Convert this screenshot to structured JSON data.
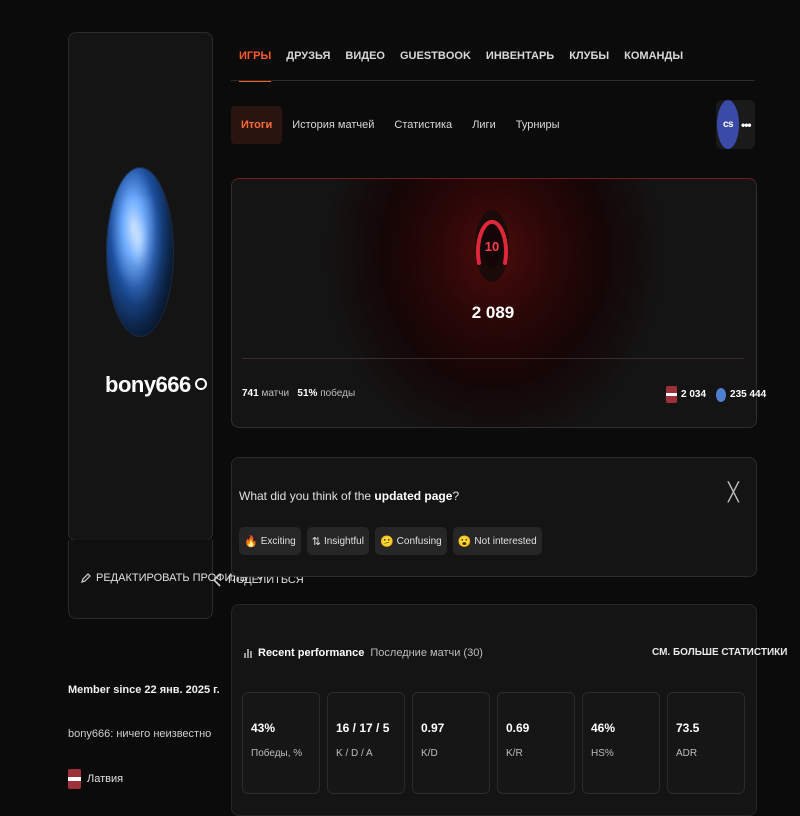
{
  "profile": {
    "username": "bony666",
    "edit_label": "РЕДАКТИРОВАТЬ ПРОФИЛЬ",
    "share_label": "ПОДЕЛИТЬСЯ",
    "member_since": "Member since 22 янв. 2025 г.",
    "bio": "bony666: ничего неизвестно",
    "country": "Латвия"
  },
  "top_tabs": [
    {
      "label": "ИГРЫ",
      "active": true
    },
    {
      "label": "ДРУЗЬЯ"
    },
    {
      "label": "ВИДЕО"
    },
    {
      "label": "GUESTBOOK"
    },
    {
      "label": "ИНВЕНТАРЬ"
    },
    {
      "label": "КЛУБЫ"
    },
    {
      "label": "КОМАНДЫ"
    }
  ],
  "sub_tabs": [
    {
      "label": "Итоги",
      "active": true
    },
    {
      "label": "История матчей"
    },
    {
      "label": "Статистика"
    },
    {
      "label": "Лиги"
    },
    {
      "label": "Турниры"
    }
  ],
  "game": {
    "logo_text": "cs",
    "more": "•••"
  },
  "elo": {
    "level": "10",
    "value": "2 089",
    "matches_count": "741",
    "matches_label": "матчи",
    "wins_pct": "51%",
    "wins_label": "победы",
    "country_rank": "2 034",
    "global_rank": "235 444"
  },
  "feedback": {
    "question_prefix": "What did you think of the ",
    "question_bold": "updated page",
    "question_suffix": "?",
    "close": "╳",
    "reactions": [
      {
        "icon": "🔥",
        "label": "Exciting"
      },
      {
        "icon": "⇅",
        "label": "Insightful"
      },
      {
        "icon": "😕",
        "label": "Confusing"
      },
      {
        "icon": "😮",
        "label": "Not interested"
      }
    ]
  },
  "performance": {
    "title": "Recent performance",
    "subtitle": "Последние матчи (30)",
    "more_link": "СМ. БОЛЬШЕ СТАТИСТИКИ",
    "stats": [
      {
        "value": "43%",
        "label": "Победы, %"
      },
      {
        "value": "16 / 17 / 5",
        "label": "K / D / A"
      },
      {
        "value": "0.97",
        "label": "K/D"
      },
      {
        "value": "0.69",
        "label": "K/R"
      },
      {
        "value": "46%",
        "label": "HS%"
      },
      {
        "value": "73.5",
        "label": "ADR"
      }
    ]
  },
  "colors": {
    "accent": "#ff5a2a",
    "level_red": "#e0263a",
    "background": "#0b0b0b"
  }
}
